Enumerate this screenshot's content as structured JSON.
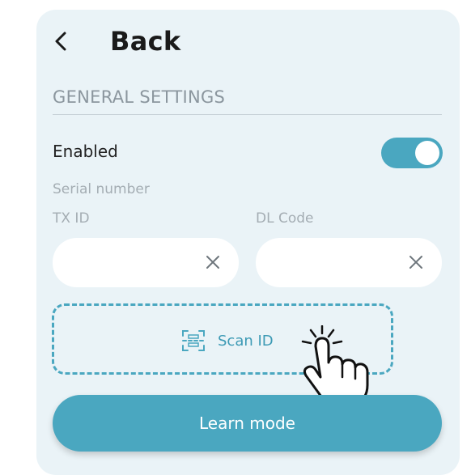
{
  "header": {
    "back_label": "Back",
    "back_icon": "chevron-left-icon"
  },
  "section": {
    "title": "GENERAL SETTINGS"
  },
  "enabled": {
    "label": "Enabled",
    "on": true
  },
  "serial": {
    "label": "Serial number"
  },
  "fields": {
    "txid": {
      "label": "TX ID",
      "value": "",
      "placeholder": "",
      "clear_icon": "close-icon"
    },
    "dlcode": {
      "label": "DL Code",
      "value": "",
      "placeholder": "",
      "clear_icon": "close-icon"
    }
  },
  "scan": {
    "label": "Scan ID",
    "icon": "scan-frame-icon"
  },
  "learn_mode": {
    "label": "Learn mode"
  },
  "overlay": {
    "icon": "pointing-hand-icon"
  },
  "colors": {
    "accent": "#4aa7c0",
    "panel": "#eaf3f7",
    "muted_text": "#a4adb3"
  }
}
